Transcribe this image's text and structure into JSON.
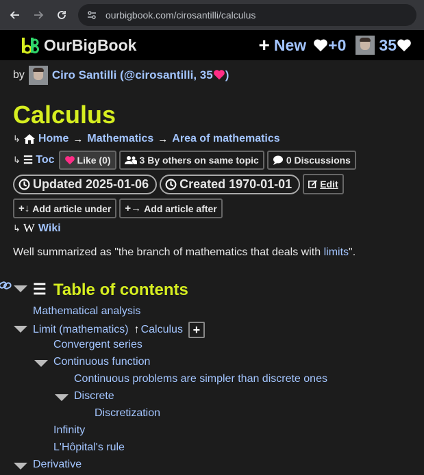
{
  "browser": {
    "url": "ourbigbook.com/cirosantilli/calculus"
  },
  "topbar": {
    "logo_text": "OurBigBook",
    "new_label": "New",
    "new_score": "+0",
    "user_score": "35"
  },
  "byline": {
    "by": "by",
    "author": "Ciro Santilli (@cirosantilli, 35",
    "close": ")"
  },
  "article": {
    "title": "Calculus",
    "breadcrumb": [
      "Home",
      "Mathematics",
      "Area of mathematics"
    ],
    "toc_link": "Toc",
    "like_label": "Like (0)",
    "same_topic_label": "3 By others on same topic",
    "discussions_label": "0 Discussions",
    "updated_label": "Updated 2025-01-06",
    "created_label": "Created 1970-01-01",
    "edit_label": "Edit",
    "add_under_label": "Add article under",
    "add_after_label": "Add article after",
    "wiki_label": "Wiki",
    "intro_prefix": "Well summarized as \"the branch of mathematics that deals with ",
    "intro_link": "limits",
    "intro_suffix": "\"."
  },
  "toc": {
    "title": "Table of contents",
    "items": [
      {
        "label": "Mathematical analysis"
      },
      {
        "label": "Limit (mathematics)",
        "parent_link": "Calculus"
      },
      {
        "label": "Convergent series"
      },
      {
        "label": "Continuous function"
      },
      {
        "label": "Continuous problems are simpler than discrete ones"
      },
      {
        "label": "Discrete"
      },
      {
        "label": "Discretization"
      },
      {
        "label": "Infinity"
      },
      {
        "label": "L'Hôpital's rule"
      },
      {
        "label": "Derivative"
      }
    ]
  },
  "colors": {
    "title": "#d6ee20",
    "link": "#a3c5ff",
    "heart": "#ff2d86"
  }
}
